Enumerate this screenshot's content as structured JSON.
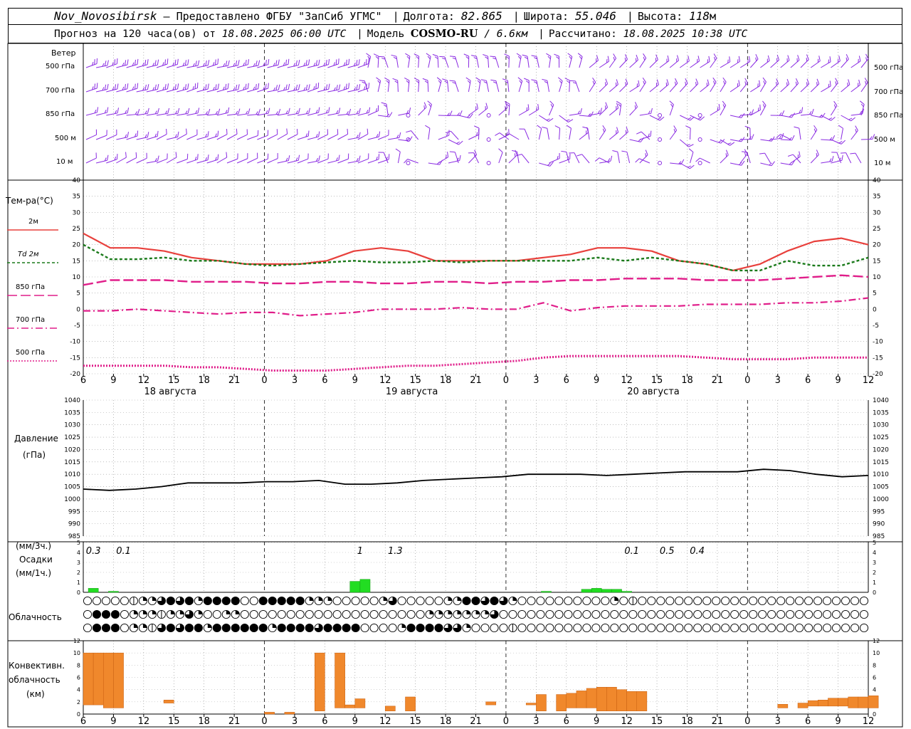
{
  "header": {
    "station": "Nov_Novosibirsk",
    "provider": "– Предоставлено ФГБУ \"ЗапСиб УГМС\"",
    "lon_label": "Долгота:",
    "lon_value": "82.865",
    "lat_label": "Широта:",
    "lat_value": "55.046",
    "alt_label": "Высота:",
    "alt_value": "118",
    "alt_unit": "м",
    "forecast_text": "Прогноз на 120 часа(ов) от",
    "forecast_from": "18.08.2025 06:00 UTC",
    "model_label": "Модель",
    "model_name": "COSMO-RU",
    "model_res": "/ 6.6км",
    "calc_label": "Рассчитано:",
    "calc_time": "18.08.2025 10:38 UTC"
  },
  "labels": {
    "wind_title": "Ветер",
    "wind_levels": [
      "500 гПа",
      "700 гПа",
      "850 гПа",
      "500 м",
      "10  м"
    ],
    "temp_title": "Тем-ра(°С)",
    "legend": [
      "2м",
      "Td  2м",
      "850 гПа",
      "700 гПа",
      "500 гПа"
    ],
    "pressure_title": "Давление",
    "pressure_unit": "(гПа)",
    "precip_unit3": "(мм/3ч.)",
    "precip_title": "Осадки",
    "precip_unit1": "(мм/1ч.)",
    "cloud_title": "Облачность",
    "conv_title1": "Конвективн.",
    "conv_title2": "облачность",
    "conv_unit": "(км)"
  },
  "chart_data": [
    {
      "type": "line",
      "title": "Тем-ра(°С)",
      "x_ticks": [
        "6",
        "9",
        "12",
        "15",
        "18",
        "21",
        "0",
        "3",
        "6",
        "9",
        "12",
        "15",
        "18",
        "21",
        "0",
        "3",
        "6",
        "9",
        "12",
        "15",
        "18",
        "21",
        "0",
        "3",
        "6",
        "9",
        "12"
      ],
      "dates": [
        "18 августа",
        "19 августа",
        "20 августа"
      ],
      "ylim": [
        -20,
        40
      ],
      "y_ticks": [
        -20,
        -15,
        -10,
        -5,
        0,
        5,
        10,
        15,
        20,
        25,
        30,
        35,
        40
      ],
      "hours": [
        0,
        3,
        6,
        9,
        12,
        15,
        18,
        21,
        24,
        27,
        30,
        33,
        36,
        39,
        42,
        45,
        48,
        51,
        54,
        57,
        60,
        63,
        66,
        69,
        72,
        75,
        78
      ],
      "series": [
        {
          "name": "2м",
          "color": "#e8403c",
          "dash": "",
          "width": 2.2,
          "values": [
            23.5,
            19,
            19,
            18,
            16,
            15,
            14,
            14,
            14,
            15,
            18,
            19,
            18,
            15,
            15,
            15,
            15,
            16,
            17,
            19,
            19,
            18,
            15,
            14,
            12,
            14,
            18,
            21,
            22,
            20
          ]
        },
        {
          "name": "Td 2м",
          "color": "#1a7a1a",
          "dash": "4 3",
          "width": 2.4,
          "values": [
            20,
            15.5,
            15.5,
            16,
            15,
            15,
            14,
            13.5,
            14,
            14.5,
            15,
            14.5,
            14.5,
            15,
            14.5,
            15,
            15,
            15,
            15,
            16,
            15,
            16,
            15,
            14,
            12,
            12,
            15,
            13.5,
            13.5,
            16
          ]
        },
        {
          "name": "850 гПа",
          "color": "#e01e8a",
          "dash": "14 5",
          "width": 2.4,
          "values": [
            7.5,
            9,
            9,
            9,
            8.5,
            8.5,
            8.5,
            8,
            8,
            8.5,
            8.5,
            8,
            8,
            8.5,
            8.5,
            8,
            8.5,
            8.5,
            9,
            9,
            9.5,
            9.5,
            9.5,
            9,
            9,
            9,
            9.5,
            10,
            10.5,
            10
          ]
        },
        {
          "name": "700 гПа",
          "color": "#e01e8a",
          "dash": "10 4 2 4",
          "width": 2.2,
          "values": [
            -0.5,
            -0.5,
            0,
            -0.5,
            -1,
            -1.5,
            -1,
            -1,
            -2,
            -1.5,
            -1,
            0,
            0,
            0,
            0.5,
            0,
            0,
            2,
            -0.5,
            0.5,
            1,
            1,
            1,
            1.5,
            1.5,
            1.5,
            2,
            2,
            2.5,
            3.5
          ]
        },
        {
          "name": "500 гПа",
          "color": "#e01e8a",
          "dash": "2 2",
          "width": 3,
          "values": [
            -17.5,
            -17.5,
            -17.5,
            -17.5,
            -18,
            -18,
            -18.5,
            -19,
            -19,
            -19,
            -18.5,
            -18,
            -17.5,
            -17.5,
            -17,
            -16.5,
            -16,
            -15,
            -14.5,
            -14.5,
            -14.5,
            -14.5,
            -14.5,
            -15,
            -15.5,
            -15.5,
            -15.5,
            -15,
            -15,
            -15
          ]
        }
      ]
    },
    {
      "type": "line",
      "title": "Давление",
      "ylim": [
        985,
        1040
      ],
      "y_ticks": [
        985,
        990,
        995,
        1000,
        1005,
        1010,
        1015,
        1020,
        1025,
        1030,
        1035,
        1040
      ],
      "series": [
        {
          "name": "",
          "color": "#000000",
          "values": [
            1004,
            1003.5,
            1004,
            1005,
            1006.5,
            1006.5,
            1006.5,
            1007,
            1007,
            1007.5,
            1006,
            1006,
            1006.5,
            1007.5,
            1008,
            1008.5,
            1009,
            1010,
            1010,
            1010,
            1009.5,
            1010,
            1010.5,
            1011,
            1011,
            1011,
            1012,
            1011.5,
            1010,
            1009,
            1009.5
          ]
        }
      ]
    },
    {
      "type": "bar",
      "title": "Осадки",
      "ylim": [
        0,
        5
      ],
      "y_ticks": [
        0,
        1,
        2,
        3,
        4,
        5
      ],
      "labels_3h": [
        {
          "text": "0.3",
          "hour": 1
        },
        {
          "text": "0.1",
          "hour": 4
        },
        {
          "text": "1",
          "hour": 27.5
        },
        {
          "text": "1.3",
          "hour": 31
        },
        {
          "text": "0.1",
          "hour": 54.5
        },
        {
          "text": "0.5",
          "hour": 58
        },
        {
          "text": "0.4",
          "hour": 61
        }
      ],
      "bars_1h": [
        {
          "hour": 1,
          "value": 0.4
        },
        {
          "hour": 3,
          "value": 0.1
        },
        {
          "hour": 27,
          "value": 1.1
        },
        {
          "hour": 28,
          "value": 1.3
        },
        {
          "hour": 46,
          "value": 0.1
        },
        {
          "hour": 50,
          "value": 0.3
        },
        {
          "hour": 51,
          "value": 0.4
        },
        {
          "hour": 52,
          "value": 0.3
        },
        {
          "hour": 53,
          "value": 0.3
        },
        {
          "hour": 54,
          "value": 0.1
        }
      ]
    },
    {
      "type": "bar",
      "title": "Конвективн. облачность",
      "ylim": [
        0,
        12
      ],
      "y_ticks": [
        0,
        2,
        4,
        6,
        8,
        10,
        12
      ],
      "bars": [
        {
          "hour": 0.5,
          "bottom": 1.5,
          "top": 10
        },
        {
          "hour": 1.5,
          "bottom": 1.5,
          "top": 10
        },
        {
          "hour": 2.5,
          "bottom": 1,
          "top": 10
        },
        {
          "hour": 3.5,
          "bottom": 1,
          "top": 10
        },
        {
          "hour": 8.5,
          "bottom": 1.8,
          "top": 2.3
        },
        {
          "hour": 18.5,
          "bottom": 0,
          "top": 0.3
        },
        {
          "hour": 20.5,
          "bottom": 0,
          "top": 0.3
        },
        {
          "hour": 23.5,
          "bottom": 0.5,
          "top": 10
        },
        {
          "hour": 25.5,
          "bottom": 1,
          "top": 10
        },
        {
          "hour": 26.5,
          "bottom": 1,
          "top": 1.5
        },
        {
          "hour": 27.5,
          "bottom": 1,
          "top": 2.5
        },
        {
          "hour": 30.5,
          "bottom": 0.5,
          "top": 1.3
        },
        {
          "hour": 32.5,
          "bottom": 0.5,
          "top": 2.8
        },
        {
          "hour": 40.5,
          "bottom": 1.5,
          "top": 2
        },
        {
          "hour": 44.5,
          "bottom": 1.5,
          "top": 1.8
        },
        {
          "hour": 45.5,
          "bottom": 0.5,
          "top": 3.2
        },
        {
          "hour": 47.5,
          "bottom": 0.5,
          "top": 3.2
        },
        {
          "hour": 48.5,
          "bottom": 1,
          "top": 3.4
        },
        {
          "hour": 49.5,
          "bottom": 1,
          "top": 3.8
        },
        {
          "hour": 50.5,
          "bottom": 1,
          "top": 4.2
        },
        {
          "hour": 51.5,
          "bottom": 0.5,
          "top": 4.4
        },
        {
          "hour": 52.5,
          "bottom": 0.5,
          "top": 4.4
        },
        {
          "hour": 53.5,
          "bottom": 0.5,
          "top": 4
        },
        {
          "hour": 54.5,
          "bottom": 0.5,
          "top": 3.7
        },
        {
          "hour": 55.5,
          "bottom": 0.5,
          "top": 3.7
        },
        {
          "hour": 69.5,
          "bottom": 1,
          "top": 1.6
        },
        {
          "hour": 71.5,
          "bottom": 1,
          "top": 1.8
        },
        {
          "hour": 72.5,
          "bottom": 1.3,
          "top": 2.2
        },
        {
          "hour": 73.5,
          "bottom": 1.3,
          "top": 2.3
        },
        {
          "hour": 74.5,
          "bottom": 1.3,
          "top": 2.6
        },
        {
          "hour": 75.5,
          "bottom": 1.3,
          "top": 2.6
        },
        {
          "hour": 76.5,
          "bottom": 1,
          "top": 2.8
        },
        {
          "hour": 77.5,
          "bottom": 1,
          "top": 2.8
        },
        {
          "hour": 78.5,
          "bottom": 1,
          "top": 3
        }
      ]
    }
  ],
  "cloud_rows": [
    "0000012234342444455444442220000023000002244343200000000002010000000000000000000000000",
    "0444022212232002200000000000000000000222222230000000000000000000000000000000000000000",
    "0444022134344244444424444344440000244443320000100000000000000000000000000000000000000"
  ],
  "colors": {
    "temp2m": "#e8403c",
    "td": "#1a7a1a",
    "upper": "#e01e8a",
    "wind": "#8a2be2",
    "precip": "#22dd22",
    "conv": "#f0882c"
  }
}
